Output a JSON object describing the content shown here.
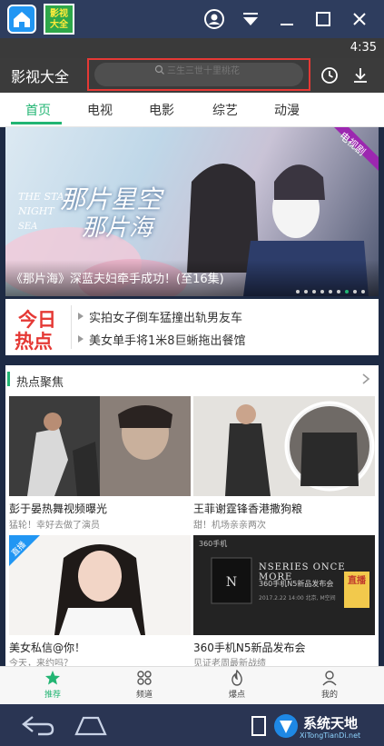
{
  "emulator": {
    "app_icon_text": "影视\n大全"
  },
  "status": {
    "time": "4:35"
  },
  "header": {
    "app_title": "影视大全",
    "search_placeholder": "三生三世十里桃花"
  },
  "tabs": [
    "首页",
    "电视",
    "电影",
    "综艺",
    "动漫"
  ],
  "banner": {
    "badge": "电视剧",
    "caption": "《那片海》深蓝夫妇牵手成功！(至16集)",
    "poster_text_1": "那片星空",
    "poster_text_2": "那片海",
    "dot_count": 9,
    "active_dot": 6
  },
  "hot_news": {
    "logo_line_1": "今日",
    "logo_line_2": "热点",
    "items": [
      "实拍女子倒车猛撞出轨男友车",
      "美女单手将1米8巨蜥拖出餐馆"
    ]
  },
  "section": {
    "title": "热点聚焦"
  },
  "grid": [
    {
      "title": "彭于晏热舞视频曝光",
      "subtitle": "猛轮！幸好去做了演员"
    },
    {
      "title": "王菲谢霆锋香港撒狗粮",
      "subtitle": "甜！机场亲亲两次"
    },
    {
      "title": "美女私信@你！",
      "subtitle": "今天，来约吗？",
      "badge": "直播"
    },
    {
      "title": "360手机N5新品发布会",
      "subtitle": "见证老周最新战绩",
      "poster_text_1": "NSERIES ONCE MORE",
      "poster_text_2": "360手机N5新品发布会",
      "poster_text_3": "2017.2.22 14:00 北京, M空间",
      "badge": "直播",
      "brand": "360手机"
    }
  ],
  "bottom_nav": [
    "推荐",
    "频道",
    "爆点",
    "我的"
  ],
  "watermark": {
    "name": "系统天地",
    "url": "XiTongTianDi.net"
  },
  "colors": {
    "accent": "#22b573",
    "highlight": "#e53935"
  }
}
